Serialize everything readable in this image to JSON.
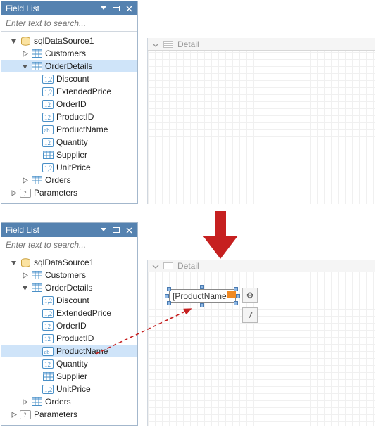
{
  "top": {
    "header": {
      "title": "Field List"
    },
    "search": {
      "placeholder": "Enter text to search..."
    },
    "tree": [
      {
        "indent": 0,
        "exp": "open",
        "icon": "db",
        "label": "sqlDataSource1"
      },
      {
        "indent": 1,
        "exp": "closed",
        "icon": "table",
        "label": "Customers"
      },
      {
        "indent": 1,
        "exp": "open",
        "icon": "table",
        "label": "OrderDetails",
        "selected": true
      },
      {
        "indent": 2,
        "exp": "none",
        "icon": "num12",
        "label": "Discount"
      },
      {
        "indent": 2,
        "exp": "none",
        "icon": "num12",
        "label": "ExtendedPrice"
      },
      {
        "indent": 2,
        "exp": "none",
        "icon": "int12",
        "label": "OrderID"
      },
      {
        "indent": 2,
        "exp": "none",
        "icon": "int12",
        "label": "ProductID"
      },
      {
        "indent": 2,
        "exp": "none",
        "icon": "txt",
        "label": "ProductName"
      },
      {
        "indent": 2,
        "exp": "none",
        "icon": "int12",
        "label": "Quantity"
      },
      {
        "indent": 2,
        "exp": "none",
        "icon": "table",
        "label": "Supplier"
      },
      {
        "indent": 2,
        "exp": "none",
        "icon": "num12",
        "label": "UnitPrice"
      },
      {
        "indent": 1,
        "exp": "closed",
        "icon": "table",
        "label": "Orders"
      },
      {
        "indent": 0,
        "exp": "closed",
        "icon": "param",
        "label": "Parameters"
      }
    ]
  },
  "bottom": {
    "header": {
      "title": "Field List"
    },
    "search": {
      "placeholder": "Enter text to search..."
    },
    "tree": [
      {
        "indent": 0,
        "exp": "open",
        "icon": "db",
        "label": "sqlDataSource1"
      },
      {
        "indent": 1,
        "exp": "closed",
        "icon": "table",
        "label": "Customers"
      },
      {
        "indent": 1,
        "exp": "open",
        "icon": "table",
        "label": "OrderDetails"
      },
      {
        "indent": 2,
        "exp": "none",
        "icon": "num12",
        "label": "Discount"
      },
      {
        "indent": 2,
        "exp": "none",
        "icon": "num12",
        "label": "ExtendedPrice"
      },
      {
        "indent": 2,
        "exp": "none",
        "icon": "int12",
        "label": "OrderID"
      },
      {
        "indent": 2,
        "exp": "none",
        "icon": "int12",
        "label": "ProductID"
      },
      {
        "indent": 2,
        "exp": "none",
        "icon": "txt",
        "label": "ProductName",
        "selected": true
      },
      {
        "indent": 2,
        "exp": "none",
        "icon": "int12",
        "label": "Quantity"
      },
      {
        "indent": 2,
        "exp": "none",
        "icon": "table",
        "label": "Supplier"
      },
      {
        "indent": 2,
        "exp": "none",
        "icon": "num12",
        "label": "UnitPrice"
      },
      {
        "indent": 1,
        "exp": "closed",
        "icon": "table",
        "label": "Orders"
      },
      {
        "indent": 0,
        "exp": "closed",
        "icon": "param",
        "label": "Parameters"
      }
    ]
  },
  "designer": {
    "band_label": "Detail",
    "drop_text": "[ProductName",
    "smart_gear": "⚙",
    "smart_fx": "𝑓"
  }
}
